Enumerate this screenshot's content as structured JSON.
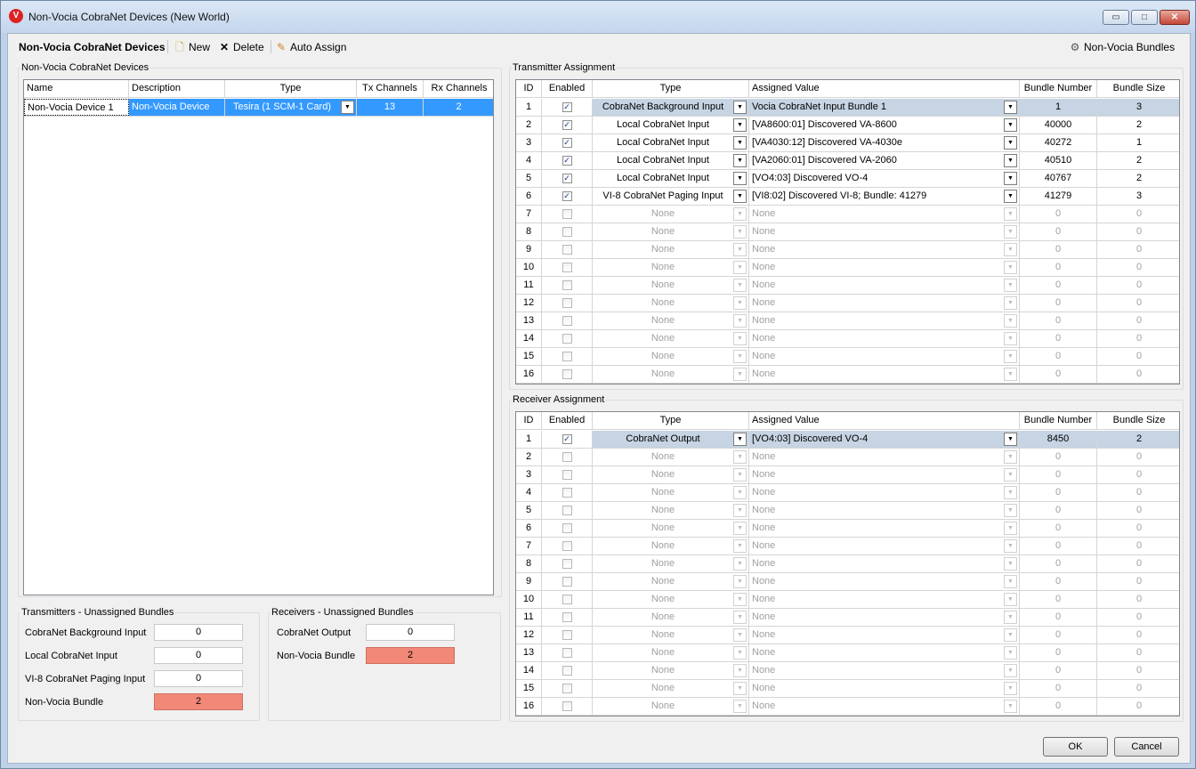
{
  "window": {
    "title": "Non-Vocia CobraNet Devices (New World)",
    "icon": "vocia-v-icon",
    "controls": {
      "minimize": "▭",
      "maximize": "□",
      "close": "✕"
    }
  },
  "toolbar": {
    "title": "Non-Vocia CobraNet Devices",
    "new_label": "New",
    "delete_label": "Delete",
    "auto_assign_label": "Auto Assign",
    "bundles_label": "Non-Vocia Bundles"
  },
  "devices": {
    "group_label": "Non-Vocia CobraNet Devices",
    "columns": [
      "Name",
      "Description",
      "Type",
      "Tx Channels",
      "Rx Channels"
    ],
    "rows": [
      {
        "name": "Non-Vocia Device 1",
        "description": "Non-Vocia Device",
        "type": "Tesira (1 SCM-1 Card)",
        "tx": "13",
        "rx": "2"
      }
    ]
  },
  "tx_unassigned": {
    "label": "Transmitters - Unassigned Bundles",
    "items": [
      {
        "label": "CobraNet Background Input",
        "value": "0",
        "alert": false
      },
      {
        "label": "Local CobraNet Input",
        "value": "0",
        "alert": false
      },
      {
        "label": "VI-8 CobraNet Paging Input",
        "value": "0",
        "alert": false
      },
      {
        "label": "Non-Vocia Bundle",
        "value": "2",
        "alert": true
      }
    ]
  },
  "rx_unassigned": {
    "label": "Receivers - Unassigned Bundles",
    "items": [
      {
        "label": "CobraNet Output",
        "value": "0",
        "alert": false
      },
      {
        "label": "Non-Vocia Bundle",
        "value": "2",
        "alert": true
      }
    ]
  },
  "transmitter": {
    "label": "Transmitter Assignment",
    "columns": [
      "ID",
      "Enabled",
      "Type",
      "Assigned Value",
      "Bundle Number",
      "Bundle Size"
    ],
    "rows": [
      {
        "id": "1",
        "enabled": true,
        "type": "CobraNet Background Input",
        "value": "Vocia CobraNet Input Bundle 1",
        "bundle": "1",
        "size": "3"
      },
      {
        "id": "2",
        "enabled": true,
        "type": "Local CobraNet Input",
        "value": "[VA8600:01] Discovered VA-8600",
        "bundle": "40000",
        "size": "2"
      },
      {
        "id": "3",
        "enabled": true,
        "type": "Local CobraNet Input",
        "value": "[VA4030:12] Discovered VA-4030e",
        "bundle": "40272",
        "size": "1"
      },
      {
        "id": "4",
        "enabled": true,
        "type": "Local CobraNet Input",
        "value": "[VA2060:01] Discovered VA-2060",
        "bundle": "40510",
        "size": "2"
      },
      {
        "id": "5",
        "enabled": true,
        "type": "Local CobraNet Input",
        "value": "[VO4:03] Discovered VO-4",
        "bundle": "40767",
        "size": "2"
      },
      {
        "id": "6",
        "enabled": true,
        "type": "VI-8 CobraNet Paging Input",
        "value": "[VI8:02] Discovered VI-8; Bundle: 41279",
        "bundle": "41279",
        "size": "3"
      },
      {
        "id": "7",
        "enabled": false,
        "type": "None",
        "value": "None",
        "bundle": "0",
        "size": "0"
      },
      {
        "id": "8",
        "enabled": false,
        "type": "None",
        "value": "None",
        "bundle": "0",
        "size": "0"
      },
      {
        "id": "9",
        "enabled": false,
        "type": "None",
        "value": "None",
        "bundle": "0",
        "size": "0"
      },
      {
        "id": "10",
        "enabled": false,
        "type": "None",
        "value": "None",
        "bundle": "0",
        "size": "0"
      },
      {
        "id": "11",
        "enabled": false,
        "type": "None",
        "value": "None",
        "bundle": "0",
        "size": "0"
      },
      {
        "id": "12",
        "enabled": false,
        "type": "None",
        "value": "None",
        "bundle": "0",
        "size": "0"
      },
      {
        "id": "13",
        "enabled": false,
        "type": "None",
        "value": "None",
        "bundle": "0",
        "size": "0"
      },
      {
        "id": "14",
        "enabled": false,
        "type": "None",
        "value": "None",
        "bundle": "0",
        "size": "0"
      },
      {
        "id": "15",
        "enabled": false,
        "type": "None",
        "value": "None",
        "bundle": "0",
        "size": "0"
      },
      {
        "id": "16",
        "enabled": false,
        "type": "None",
        "value": "None",
        "bundle": "0",
        "size": "0"
      }
    ]
  },
  "receiver": {
    "label": "Receiver Assignment",
    "columns": [
      "ID",
      "Enabled",
      "Type",
      "Assigned Value",
      "Bundle Number",
      "Bundle Size"
    ],
    "rows": [
      {
        "id": "1",
        "enabled": true,
        "type": "CobraNet Output",
        "value": "[VO4:03] Discovered VO-4",
        "bundle": "8450",
        "size": "2"
      },
      {
        "id": "2",
        "enabled": false,
        "type": "None",
        "value": "None",
        "bundle": "0",
        "size": "0"
      },
      {
        "id": "3",
        "enabled": false,
        "type": "None",
        "value": "None",
        "bundle": "0",
        "size": "0"
      },
      {
        "id": "4",
        "enabled": false,
        "type": "None",
        "value": "None",
        "bundle": "0",
        "size": "0"
      },
      {
        "id": "5",
        "enabled": false,
        "type": "None",
        "value": "None",
        "bundle": "0",
        "size": "0"
      },
      {
        "id": "6",
        "enabled": false,
        "type": "None",
        "value": "None",
        "bundle": "0",
        "size": "0"
      },
      {
        "id": "7",
        "enabled": false,
        "type": "None",
        "value": "None",
        "bundle": "0",
        "size": "0"
      },
      {
        "id": "8",
        "enabled": false,
        "type": "None",
        "value": "None",
        "bundle": "0",
        "size": "0"
      },
      {
        "id": "9",
        "enabled": false,
        "type": "None",
        "value": "None",
        "bundle": "0",
        "size": "0"
      },
      {
        "id": "10",
        "enabled": false,
        "type": "None",
        "value": "None",
        "bundle": "0",
        "size": "0"
      },
      {
        "id": "11",
        "enabled": false,
        "type": "None",
        "value": "None",
        "bundle": "0",
        "size": "0"
      },
      {
        "id": "12",
        "enabled": false,
        "type": "None",
        "value": "None",
        "bundle": "0",
        "size": "0"
      },
      {
        "id": "13",
        "enabled": false,
        "type": "None",
        "value": "None",
        "bundle": "0",
        "size": "0"
      },
      {
        "id": "14",
        "enabled": false,
        "type": "None",
        "value": "None",
        "bundle": "0",
        "size": "0"
      },
      {
        "id": "15",
        "enabled": false,
        "type": "None",
        "value": "None",
        "bundle": "0",
        "size": "0"
      },
      {
        "id": "16",
        "enabled": false,
        "type": "None",
        "value": "None",
        "bundle": "0",
        "size": "0"
      }
    ]
  },
  "dialog": {
    "ok_label": "OK",
    "cancel_label": "Cancel"
  },
  "colors": {
    "selection": "#3399ff",
    "assigned_row": "#c6d4e3",
    "alert": "#f28878"
  }
}
